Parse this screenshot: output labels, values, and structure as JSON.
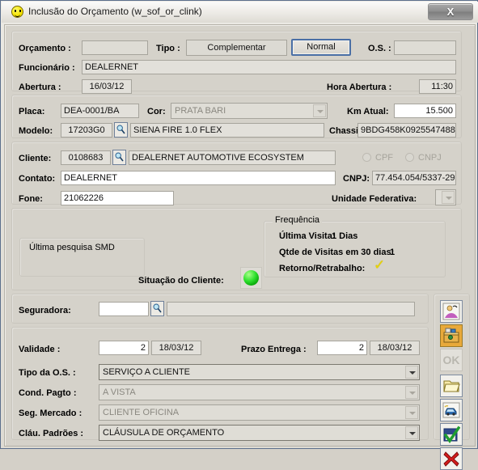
{
  "window": {
    "title": "Inclusão do Orçamento (w_sof_or_clink)",
    "icon": "smiley-icon",
    "close_label": "X"
  },
  "form": {
    "orcamento": {
      "label": "Orçamento :",
      "value": ""
    },
    "tipo": {
      "label": "Tipo :",
      "option_complementar": "Complementar",
      "option_normal": "Normal",
      "selected": "Normal"
    },
    "os": {
      "label": "O.S. :",
      "value": ""
    },
    "funcionario": {
      "label": "Funcionário :",
      "value": "DEALERNET"
    },
    "abertura": {
      "label": "Abertura :",
      "value": "16/03/12"
    },
    "hora_abertura": {
      "label": "Hora Abertura :",
      "value": "11:30"
    },
    "placa": {
      "label": "Placa:",
      "value": "DEA-0001/BA"
    },
    "cor": {
      "label": "Cor:",
      "value": "PRATA BARI"
    },
    "km_atual": {
      "label": "Km Atual:",
      "value": "15.500"
    },
    "modelo": {
      "label": "Modelo:",
      "code": "17203G0",
      "desc": "SIENA FIRE 1.0 FLEX"
    },
    "chassi": {
      "label": "Chassi:",
      "value": "9BDG458K0925547488"
    },
    "cliente": {
      "label": "Cliente:",
      "code": "0108683",
      "desc": "DEALERNET AUTOMOTIVE ECOSYSTEM"
    },
    "cpf_radio": {
      "label": "CPF"
    },
    "cnpj_radio": {
      "label": "CNPJ"
    },
    "contato": {
      "label": "Contato:",
      "value": "DEALERNET"
    },
    "cnpj": {
      "label": "CNPJ:",
      "value": "77.454.054/5337-29"
    },
    "fone": {
      "label": "Fone:",
      "value": "21062226"
    },
    "unidade_federativa": {
      "label": "Unidade Federativa:",
      "value": ""
    },
    "ultima_pesquisa": {
      "label": "Última pesquisa SMD"
    },
    "situacao_cliente": {
      "label": "Situação do Cliente:",
      "status_color": "#23d823"
    },
    "frequencia": {
      "legend": "Frequência",
      "ultima_visita_label": "Última Visita:",
      "ultima_visita_value": "1 Dias",
      "qtde_visitas_label": "Qtde de Visitas em 30 dias:",
      "qtde_visitas_value": "1",
      "retorno_label": "Retorno/Retrabalho:",
      "retorno_mark": "✓"
    },
    "seguradora": {
      "label": "Seguradora:",
      "code": "",
      "desc": ""
    },
    "validade": {
      "label": "Validade :",
      "days": "2",
      "date": "18/03/12"
    },
    "prazo_entrega": {
      "label": "Prazo Entrega :",
      "days": "2",
      "date": "18/03/12"
    },
    "tipo_os": {
      "label": "Tipo da O.S. :",
      "value": "SERVIÇO A CLIENTE"
    },
    "cond_pagto": {
      "label": "Cond. Pagto :",
      "value": "A VISTA"
    },
    "seg_mercado": {
      "label": "Seg. Mercado :",
      "value": "CLIENTE OFICINA"
    },
    "clau_padroes": {
      "label": "Cláu. Padrões :",
      "value": "CLÁUSULA DE ORÇAMENTO"
    }
  },
  "toolbar": {
    "buttons": [
      {
        "name": "customer-search-icon",
        "tip": "Consulta Cliente",
        "state": "enabled"
      },
      {
        "name": "toolbox-icon",
        "tip": "Ferramentas",
        "state": "active"
      },
      {
        "name": "ok-icon",
        "tip": "OK",
        "state": "disabled",
        "text": "OK"
      },
      {
        "name": "open-folder-icon",
        "tip": "Abrir",
        "state": "enabled"
      },
      {
        "name": "vehicle-icon",
        "tip": "Veículo",
        "state": "enabled"
      },
      {
        "name": "confirm-check-icon",
        "tip": "Confirmar",
        "state": "enabled"
      },
      {
        "name": "cancel-x-icon",
        "tip": "Cancelar",
        "state": "enabled",
        "text": "X"
      }
    ]
  }
}
